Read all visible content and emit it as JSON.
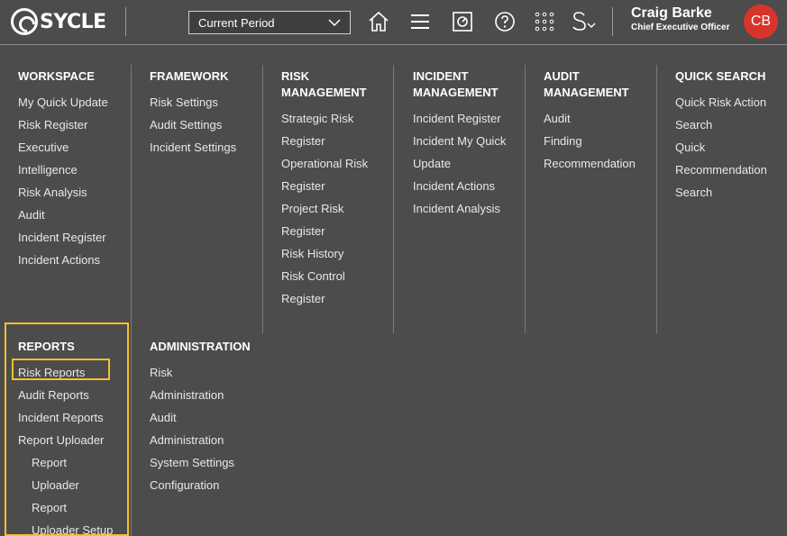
{
  "header": {
    "logo_text": "SYCLE",
    "period_select": {
      "value": "Current Period"
    },
    "user": {
      "name": "Craig Barke",
      "role": "Chief Executive Officer",
      "initials": "CB"
    },
    "colors": {
      "background": "#4c4c4c",
      "avatar": "#d9342b",
      "highlight": "#f2c12e"
    }
  },
  "menu": {
    "workspace": {
      "title": "WORKSPACE",
      "items": [
        "My Quick Update",
        "Risk Register",
        "Executive",
        "Intelligence",
        "Risk Analysis",
        "Audit",
        "Incident Register",
        "Incident Actions"
      ]
    },
    "framework": {
      "title": "FRAMEWORK",
      "items": [
        "Risk Settings",
        "Audit Settings",
        "Incident Settings"
      ]
    },
    "risk_management": {
      "title_lines": [
        "RISK",
        "MANAGEMENT"
      ],
      "items": [
        "Strategic Risk",
        "Register",
        "Operational Risk",
        "Register",
        "Project Risk",
        "Register",
        "Risk History",
        "Risk Control",
        "Register"
      ]
    },
    "incident_management": {
      "title_lines": [
        "INCIDENT",
        "MANAGEMENT"
      ],
      "items": [
        "Incident Register",
        "Incident My Quick",
        "Update",
        "Incident Actions",
        "Incident Analysis"
      ]
    },
    "audit_management": {
      "title_lines": [
        "AUDIT",
        "MANAGEMENT"
      ],
      "items": [
        "Audit",
        "Finding",
        "Recommendation"
      ]
    },
    "quick_search": {
      "title": "QUICK SEARCH",
      "items": [
        "Quick Risk Action",
        "Search",
        "Quick",
        "Recommendation",
        "Search"
      ]
    },
    "reports": {
      "title": "REPORTS",
      "items": [
        "Risk Reports",
        "Audit Reports",
        "Incident Reports",
        "Report Uploader"
      ],
      "sub_items": [
        "Report",
        "Uploader",
        "Report",
        "Uploader Setup"
      ]
    },
    "administration": {
      "title": "ADMINISTRATION",
      "items": [
        "Risk",
        "Administration",
        "Audit",
        "Administration",
        "System Settings",
        "Configuration"
      ]
    }
  }
}
